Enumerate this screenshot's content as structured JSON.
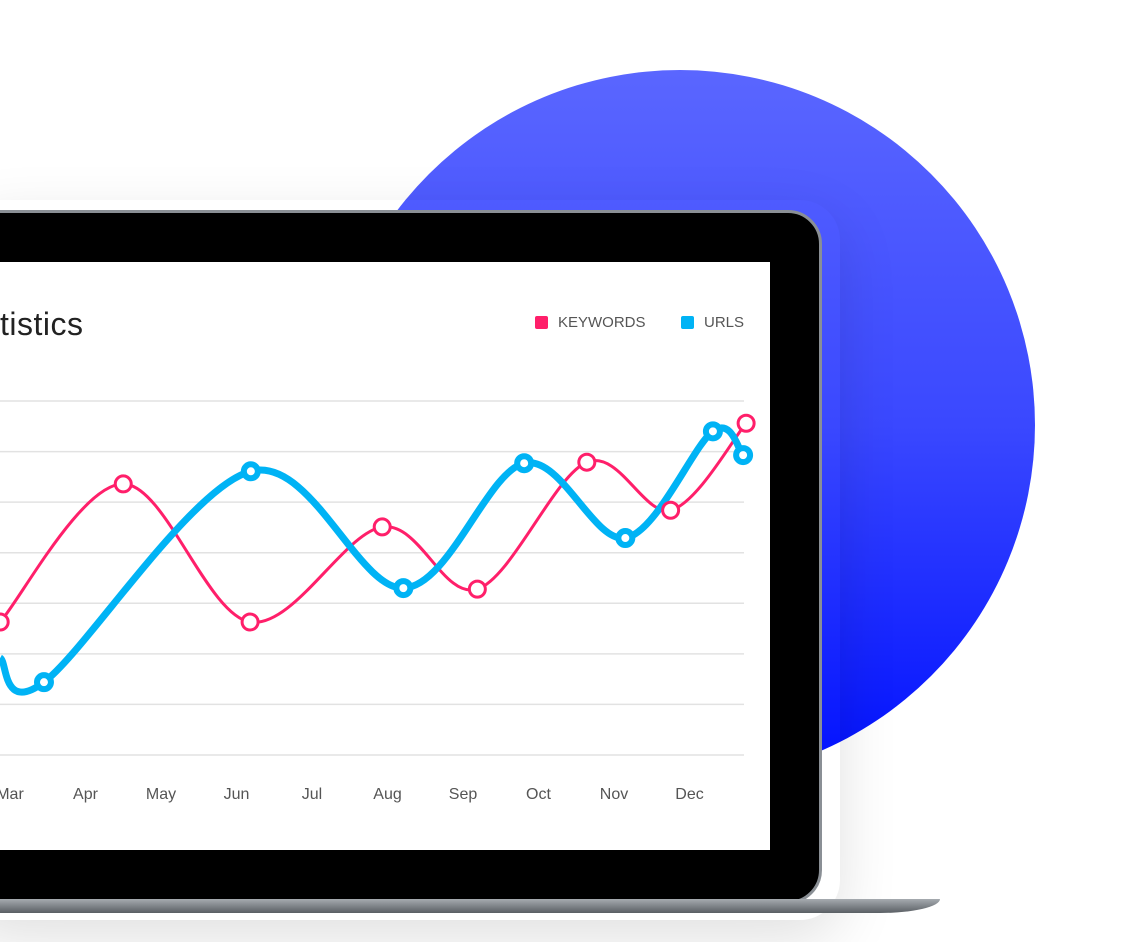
{
  "title": "tistics",
  "legend": [
    {
      "label": "KEYWORDS",
      "color": "#ff1f6a"
    },
    {
      "label": "URLS",
      "color": "#00b3f5"
    }
  ],
  "chart_data": {
    "type": "line",
    "smooth": true,
    "grid": true,
    "legend_position": "top-right",
    "x_ticks": [
      "Mar",
      "Apr",
      "May",
      "Jun",
      "Jul",
      "Aug",
      "Sep",
      "Oct",
      "Nov",
      "Dec"
    ],
    "x_tick_values": [
      3,
      4,
      5,
      6,
      7,
      8,
      9,
      10,
      11,
      12
    ],
    "xlim": [
      2.87,
      12.85
    ],
    "ylim": [
      0,
      7
    ],
    "y_gridlines": [
      0,
      1,
      2,
      3,
      4,
      5,
      6,
      7
    ],
    "series": [
      {
        "name": "KEYWORDS",
        "color": "#ff1f6a",
        "points": [
          [
            2.87,
            2.63
          ],
          [
            4.5,
            5.36
          ],
          [
            6.18,
            2.63
          ],
          [
            7.93,
            4.51
          ],
          [
            9.19,
            3.28
          ],
          [
            10.64,
            5.79
          ],
          [
            11.75,
            4.84
          ],
          [
            12.75,
            6.56
          ]
        ]
      },
      {
        "name": "URLS",
        "color": "#00b3f5",
        "points": [
          [
            2.87,
            1.92
          ],
          [
            3.45,
            1.44
          ],
          [
            6.19,
            5.61
          ],
          [
            8.21,
            3.3
          ],
          [
            9.81,
            5.77
          ],
          [
            11.15,
            4.29
          ],
          [
            12.31,
            6.4
          ],
          [
            12.71,
            5.93
          ]
        ]
      }
    ]
  }
}
